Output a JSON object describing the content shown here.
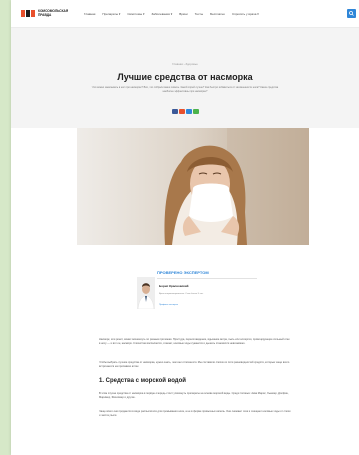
{
  "header": {
    "logo_text": "КОМСОМОЛЬСКАЯ ПРАВДА",
    "nav": [
      "Главная",
      "Препараты ▾",
      "Симптомы ▾",
      "Заболевания ▾",
      "Врачи",
      "Тесты",
      "Бесплатно",
      "Спросить у врача ▾"
    ],
    "search_icon": "search-icon"
  },
  "article": {
    "breadcrumbs": "Главная  ›  Здоровье",
    "title": "Лучшие средства от насморка",
    "lead": "Что можно закапывать в нос при насморке? Всё, что собрали ваши советы. Какой спрей лучше? Как быстро избавиться от заложенности носа? Какие средства наиболее эффективны при насморке?",
    "share_colors": [
      "#3b5998",
      "#e8502c",
      "#2f86d8",
      "#4bb34b"
    ]
  },
  "expert": {
    "heading": "ПРОВЕРЕНО ЭКСПЕРТОМ",
    "name": "Борис Красновский",
    "role": "Врач-оториноларинголог. Стаж более 5 лет.",
    "link": "Профиль эксперта"
  },
  "body": {
    "p1": "Насморк, или ринит, может возникнуть по разным причинам. Простуда, переохлаждение, вдыхание ветра, пыль или аллергия, провоцирующие сильный отек в носу — и вот он, насморк. Слизистая воспаляется, отекает, носовые ходы сужаются и дышать становится невозможно.",
    "p2": "Чтобы выбрать лучшие средства от насморка, нужно знать, чем они отличаются. Мы составили список из пяти разновидностей средств, которые чаще всего встречаются на прилавках аптек.",
    "h2": "1. Средства с морской водой",
    "p3": "В этом случае средства от насморка в первую очередь стоит упомянуть препараты на основе морской воды. Среди топовых: Аква Марис, Хьюмер, Долфин, Маример, Физиомер и другие.",
    "p4": "Чаще всего они продаются в виде распылителя для промывания носа, а не в форме привычных капель. Они снимают отек и очищают носовые ходы от слизи и частиц пыли."
  },
  "colors": {
    "accent": "#2f86d8",
    "brand": "#e8502c",
    "backdrop": "#d6e8c8"
  }
}
